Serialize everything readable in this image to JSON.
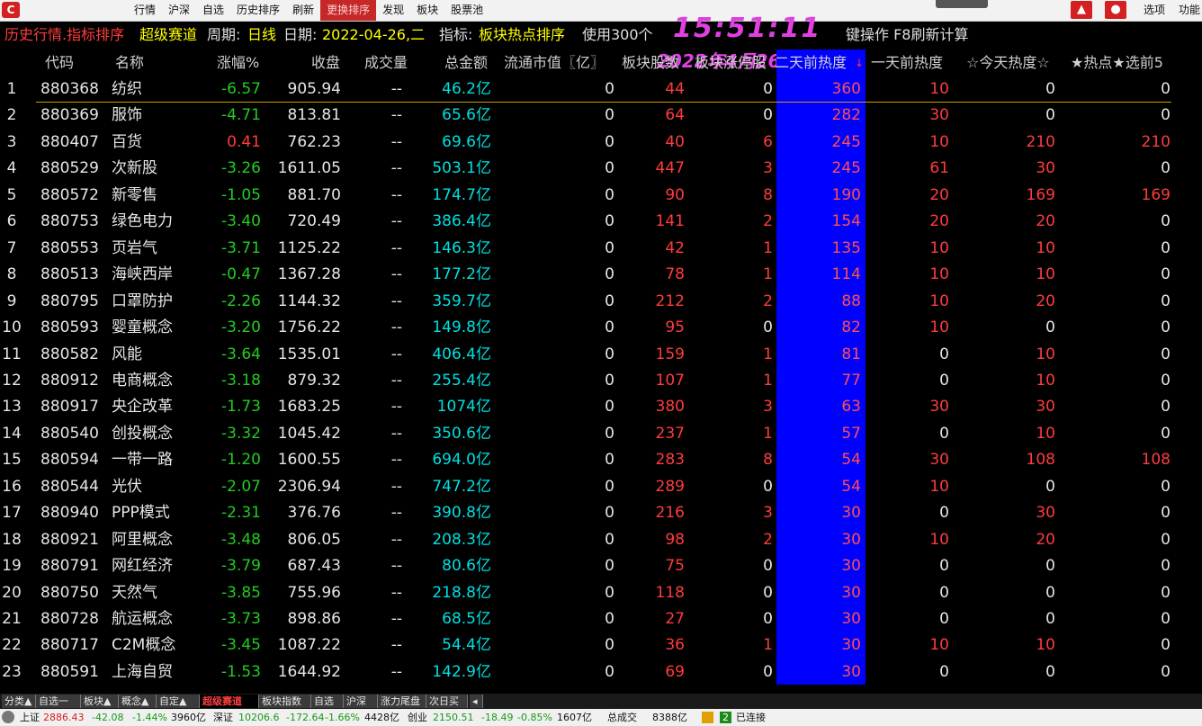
{
  "menubar": {
    "items": [
      "行情",
      "沪深",
      "自选",
      "历史排序",
      "刷新",
      "更换排序",
      "发现",
      "板块",
      "股票池"
    ],
    "active_index": 5,
    "right_items": [
      "选项",
      "功能"
    ],
    "logo_glyph": "C",
    "icons": [
      "shirt-icon",
      "user-icon"
    ]
  },
  "titlebar": {
    "title": "历史行情.指标排序",
    "board": "超级赛道",
    "period_label": "周期:",
    "period_value": "日线",
    "date_label": "日期:",
    "date_value": "2022-04-26,二",
    "indicator_label": "指标:",
    "indicator_value": "板块热点排序",
    "info_pre": "使用300个",
    "info_post": "键操作 F8刷新计算",
    "clock": "15:51:11",
    "clock_date": "2022年4月26日"
  },
  "columns": [
    "代码",
    "名称",
    "涨幅%",
    "收盘",
    "成交量",
    "总金额",
    "流通市值〖亿〗",
    "板块股数",
    "板块涨停股",
    "二天前热度",
    "一天前热度",
    "☆今天热度☆",
    "★热点★选前5"
  ],
  "sort_marker": "↓",
  "rows": [
    [
      "1",
      "880368",
      "纺织",
      "-6.57",
      "905.94",
      "--",
      "46.2亿",
      "0",
      "44",
      "0",
      "360",
      "10",
      "0",
      "0"
    ],
    [
      "2",
      "880369",
      "服饰",
      "-4.71",
      "813.81",
      "--",
      "65.6亿",
      "0",
      "64",
      "0",
      "282",
      "30",
      "0",
      "0"
    ],
    [
      "3",
      "880407",
      "百货",
      "0.41",
      "762.23",
      "--",
      "69.6亿",
      "0",
      "40",
      "6",
      "245",
      "10",
      "210",
      "210"
    ],
    [
      "4",
      "880529",
      "次新股",
      "-3.26",
      "1611.05",
      "--",
      "503.1亿",
      "0",
      "447",
      "3",
      "245",
      "61",
      "30",
      "0"
    ],
    [
      "5",
      "880572",
      "新零售",
      "-1.05",
      "881.70",
      "--",
      "174.7亿",
      "0",
      "90",
      "8",
      "190",
      "20",
      "169",
      "169"
    ],
    [
      "6",
      "880753",
      "绿色电力",
      "-3.40",
      "720.49",
      "--",
      "386.4亿",
      "0",
      "141",
      "2",
      "154",
      "20",
      "20",
      "0"
    ],
    [
      "7",
      "880553",
      "页岩气",
      "-3.71",
      "1125.22",
      "--",
      "146.3亿",
      "0",
      "42",
      "1",
      "135",
      "10",
      "10",
      "0"
    ],
    [
      "8",
      "880513",
      "海峡西岸",
      "-0.47",
      "1367.28",
      "--",
      "177.2亿",
      "0",
      "78",
      "1",
      "114",
      "10",
      "10",
      "0"
    ],
    [
      "9",
      "880795",
      "口罩防护",
      "-2.26",
      "1144.32",
      "--",
      "359.7亿",
      "0",
      "212",
      "2",
      "88",
      "10",
      "20",
      "0"
    ],
    [
      "10",
      "880593",
      "婴童概念",
      "-3.20",
      "1756.22",
      "--",
      "149.8亿",
      "0",
      "95",
      "0",
      "82",
      "10",
      "0",
      "0"
    ],
    [
      "11",
      "880582",
      "风能",
      "-3.64",
      "1535.01",
      "--",
      "406.4亿",
      "0",
      "159",
      "1",
      "81",
      "0",
      "10",
      "0"
    ],
    [
      "12",
      "880912",
      "电商概念",
      "-3.18",
      "879.32",
      "--",
      "255.4亿",
      "0",
      "107",
      "1",
      "77",
      "0",
      "10",
      "0"
    ],
    [
      "13",
      "880917",
      "央企改革",
      "-1.73",
      "1683.25",
      "--",
      "1074亿",
      "0",
      "380",
      "3",
      "63",
      "30",
      "30",
      "0"
    ],
    [
      "14",
      "880540",
      "创投概念",
      "-3.32",
      "1045.42",
      "--",
      "350.6亿",
      "0",
      "237",
      "1",
      "57",
      "0",
      "10",
      "0"
    ],
    [
      "15",
      "880594",
      "一带一路",
      "-1.20",
      "1600.55",
      "--",
      "694.0亿",
      "0",
      "283",
      "8",
      "54",
      "30",
      "108",
      "108"
    ],
    [
      "16",
      "880544",
      "光伏",
      "-2.07",
      "2306.94",
      "--",
      "747.2亿",
      "0",
      "289",
      "0",
      "54",
      "10",
      "0",
      "0"
    ],
    [
      "17",
      "880940",
      "PPP模式",
      "-2.31",
      "376.76",
      "--",
      "390.8亿",
      "0",
      "216",
      "3",
      "30",
      "0",
      "30",
      "0"
    ],
    [
      "18",
      "880921",
      "阿里概念",
      "-3.48",
      "806.05",
      "--",
      "208.3亿",
      "0",
      "98",
      "2",
      "30",
      "10",
      "20",
      "0"
    ],
    [
      "19",
      "880791",
      "网红经济",
      "-3.79",
      "687.43",
      "--",
      "80.6亿",
      "0",
      "75",
      "0",
      "30",
      "0",
      "0",
      "0"
    ],
    [
      "20",
      "880750",
      "天然气",
      "-3.85",
      "755.96",
      "--",
      "218.8亿",
      "0",
      "118",
      "0",
      "30",
      "0",
      "0",
      "0"
    ],
    [
      "21",
      "880728",
      "航运概念",
      "-3.73",
      "898.86",
      "--",
      "68.5亿",
      "0",
      "27",
      "0",
      "30",
      "0",
      "0",
      "0"
    ],
    [
      "22",
      "880717",
      "C2M概念",
      "-3.45",
      "1087.22",
      "--",
      "54.4亿",
      "0",
      "36",
      "1",
      "30",
      "10",
      "10",
      "0"
    ],
    [
      "23",
      "880591",
      "上海自贸",
      "-1.53",
      "1644.92",
      "--",
      "142.9亿",
      "0",
      "69",
      "0",
      "30",
      "0",
      "0",
      "0"
    ]
  ],
  "tabs": [
    "分类▲",
    "自选一",
    "板块▲",
    "概念▲",
    "自定▲",
    "超级赛道",
    "板块指数",
    "自选",
    "沪深",
    "涨力尾盘",
    "次日买"
  ],
  "active_tab": 5,
  "status": {
    "sh_label": "上证",
    "sh_value": "2886.43",
    "sh_change": "-42.08",
    "sh_pct": "-1.44%",
    "sh_amount": "3960亿",
    "sz_label": "深证",
    "sz_value": "10206.6",
    "sz_change": "-172.64",
    "sz_pct": "-1.66%",
    "sz_amount": "4428亿",
    "cy_label": "创业",
    "cy_value": "2150.51",
    "cy_change": "-18.49",
    "cy_pct": "-0.85%",
    "cy_amount": "1607亿",
    "total_label": "总成交",
    "total_value": "8388亿",
    "badge": "2",
    "connection": "已连接"
  },
  "colors": {
    "up": "#ff3c3c",
    "down": "#22cc22",
    "amount": "#00e0e0",
    "yellow": "#ffff00",
    "hot_column_bg": "#0000ff",
    "clock": "#e040e0"
  }
}
